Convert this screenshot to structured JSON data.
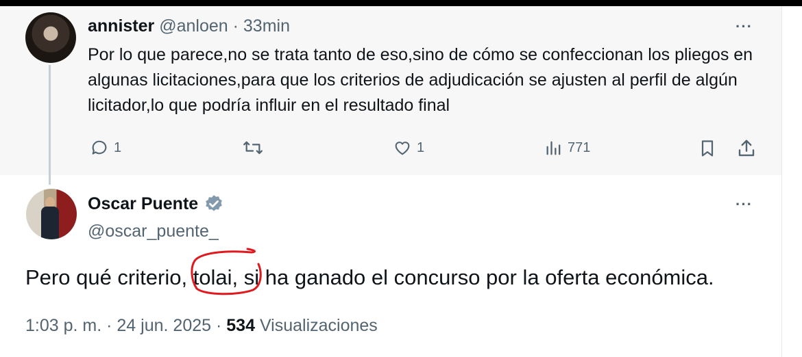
{
  "reply": {
    "name": "annister",
    "handle": "@anloen",
    "separator": "·",
    "time": "33min",
    "text": "Por lo que parece,no se trata tanto de eso,sino de cómo se confeccionan los pliegos en algunas licitaciones,para que los criterios de adjudicación se ajusten al perfil de algún licitador,lo que podría influir en el resultado final",
    "more": "···",
    "replies": "1",
    "likes": "1",
    "views": "771",
    "icons": [
      "reply-icon",
      "retweet-icon",
      "like-icon",
      "views-icon",
      "bookmark-icon",
      "share-icon"
    ]
  },
  "main": {
    "name": "Oscar Puente",
    "handle": "@oscar_puente_",
    "more": "···",
    "text": "Pero qué criterio, tolai, si ha ganado el concurso por la oferta económica.",
    "time": "1:03 p. m.",
    "dot1": "·",
    "date": "24 jun. 2025",
    "dot2": "·",
    "views_count": "534",
    "views_label": "Visualizaciones",
    "verified_color": "#829aab",
    "annotation_color": "#e0191f"
  }
}
